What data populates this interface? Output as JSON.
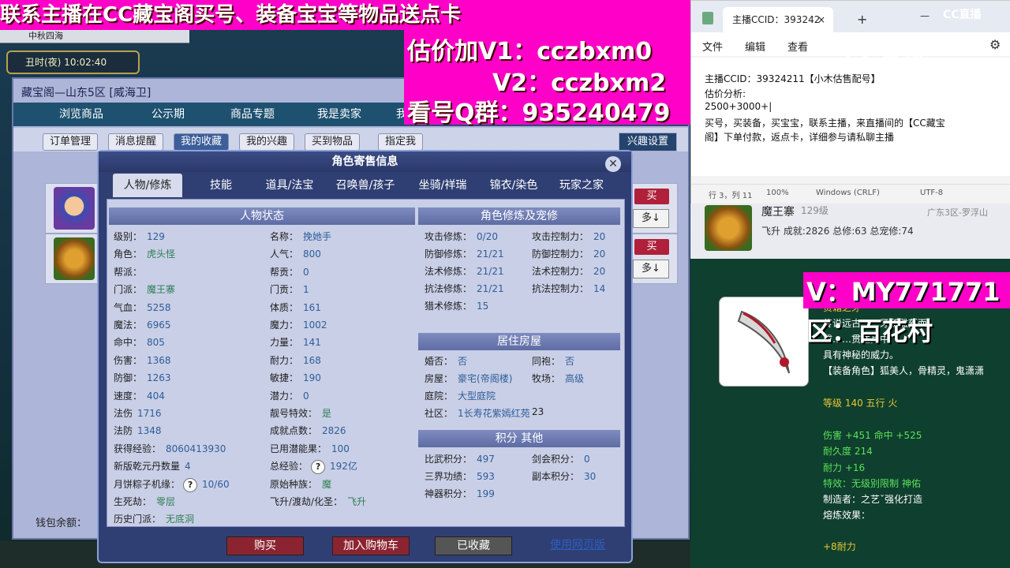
{
  "banner": {
    "line1": "联系主播在CC藏宝阁买号、装备宝宝等物品送点卡",
    "line2": "估价加V1：cczbxm0",
    "line3": "V2：cczbxm2",
    "line4": "看号Q群：935240479",
    "color": "#ff00c8"
  },
  "overlay": {
    "v_text": "V：MY771771",
    "qu_text": "区：百花村",
    "cc_logo": "CC直播",
    "cc_watermark": "CC直播"
  },
  "game": {
    "tab_label": "中秋四海 ",
    "clock": "丑时(夜)  10:02:40",
    "cbg_title": "藏宝阁—山东5区 [威海卫]",
    "tabs": [
      "浏览商品",
      "公示期",
      "商品专题",
      "我是卖家",
      "我"
    ],
    "subtabs": [
      "订单管理",
      "消息提醒",
      "我的收藏",
      "我的兴趣",
      "买到物品",
      "指定我"
    ],
    "interest_btn": "兴趣设置",
    "buy_label": "买",
    "more_label": "多↓",
    "wallet": "钱包余额："
  },
  "modal": {
    "title": "角色寄售信息",
    "close": "✕",
    "tabs": [
      "人物/修炼",
      "技能",
      "道具/法宝",
      "召唤兽/孩子",
      "坐骑/祥瑞",
      "锦衣/染色",
      "玩家之家"
    ],
    "status_head": "人物状态",
    "cultivation_head": "角色修炼及宠修",
    "house_head": "居住房屋",
    "points_head": "积分 其他",
    "left_col": [
      [
        "级别：",
        "129"
      ],
      [
        "角色：",
        "虎头怪"
      ],
      [
        "帮派：",
        ""
      ],
      [
        "门派：",
        "魔王寨"
      ],
      [
        "气血：",
        "5258"
      ],
      [
        "魔法：",
        "6965"
      ],
      [
        "命中：",
        "805"
      ],
      [
        "伤害：",
        "1368"
      ],
      [
        "防御：",
        "1263"
      ],
      [
        "速度：",
        "404"
      ],
      [
        "法伤",
        "1716"
      ],
      [
        "法防",
        "1348"
      ],
      [
        "获得经验：",
        "8060413930"
      ],
      [
        "新版乾元丹数量",
        "4"
      ],
      [
        "月饼粽子机缘：",
        "10/60"
      ],
      [
        "生死劫：",
        "零层"
      ],
      [
        "历史门派：",
        "无底洞"
      ]
    ],
    "mid_col": [
      [
        "名称：",
        "挽她手"
      ],
      [
        "人气：",
        "800"
      ],
      [
        "帮贡：",
        "0"
      ],
      [
        "门贡：",
        "1"
      ],
      [
        "体质：",
        "161"
      ],
      [
        "魔力：",
        "1002"
      ],
      [
        "力量：",
        "141"
      ],
      [
        "耐力：",
        "168"
      ],
      [
        "敏捷：",
        "190"
      ],
      [
        "潜力：",
        "0"
      ],
      [
        "靓号特效：",
        "是"
      ],
      [
        "成就点数：",
        "2826"
      ],
      [
        "已用潜能果：",
        "100"
      ],
      [
        "总经验：",
        "192亿"
      ],
      [
        "原始种族：",
        "魔"
      ],
      [
        "飞升/渡劫/化圣：",
        "飞升"
      ]
    ],
    "cult_col": [
      [
        "攻击修炼：",
        "0/20",
        "攻击控制力：",
        "20"
      ],
      [
        "防御修炼：",
        "21/21",
        "防御控制力：",
        "20"
      ],
      [
        "法术修炼：",
        "21/21",
        "法术控制力：",
        "20"
      ],
      [
        "抗法修炼：",
        "21/21",
        "抗法控制力：",
        "14"
      ],
      [
        "猎术修炼：",
        "15",
        "",
        ""
      ]
    ],
    "house": [
      [
        "婚否：",
        "否",
        "同袍：",
        "否"
      ],
      [
        "房屋：",
        "豪宅(帝阁楼)",
        "牧场：",
        "高级"
      ],
      [
        "庭院：",
        "大型庭院",
        "",
        ""
      ],
      [
        "社区：",
        "1长寿花紫嫣红苑",
        "23",
        ""
      ]
    ],
    "points": [
      [
        "比武积分：",
        "497",
        "剑会积分：",
        "0"
      ],
      [
        "三界功绩：",
        "593",
        "副本积分：",
        "30"
      ],
      [
        "神器积分：",
        "199",
        "",
        ""
      ]
    ],
    "qmark": "?",
    "buttons": {
      "buy": "购买",
      "cart": "加入购物车",
      "collected": "已收藏",
      "web": "使用网页版"
    }
  },
  "notepad": {
    "tab_title": "主播CCID：393242",
    "tab_close": "×",
    "tab_add": "+",
    "menu": [
      "文件",
      "编辑",
      "查看"
    ],
    "lines": [
      "主播CCID：39324211【小木估售配号】",
      "估价分析:",
      "2500+3000+|",
      "买号，买装备，买宝宝，联系主播，来直播间的【CC藏宝",
      "阁】下单付款，返点卡，详细参与请私聊主播"
    ],
    "status": [
      "行 3，列 11",
      "100%",
      "Windows (CRLF)",
      "UTF-8"
    ]
  },
  "item_panel": {
    "demon_name": "魔王寨",
    "demon_lv": "129级",
    "demon_server": "广东3区-罗浮山",
    "demon_stats": "飞升 成就:2826 总修:63 总宠修:74",
    "item_name": "贵霜之牙",
    "desc1": "传说远古……牙所雕刻而",
    "desc2": "成……贯注其中,",
    "desc3": "具有神秘的威力。",
    "desc4": "【装备角色】狐美人，骨精灵，鬼潇潇",
    "level": "等级 140 五行 火",
    "dmg": "伤害 +451 命中 +525",
    "durability": "耐久度 214",
    "endurance": "耐力 +16",
    "effect": "特效：无级别限制 神佑",
    "maker": "制造者：之艺ˇ强化打造",
    "refine": "熔炼效果：",
    "refine_val": "+8耐力"
  }
}
